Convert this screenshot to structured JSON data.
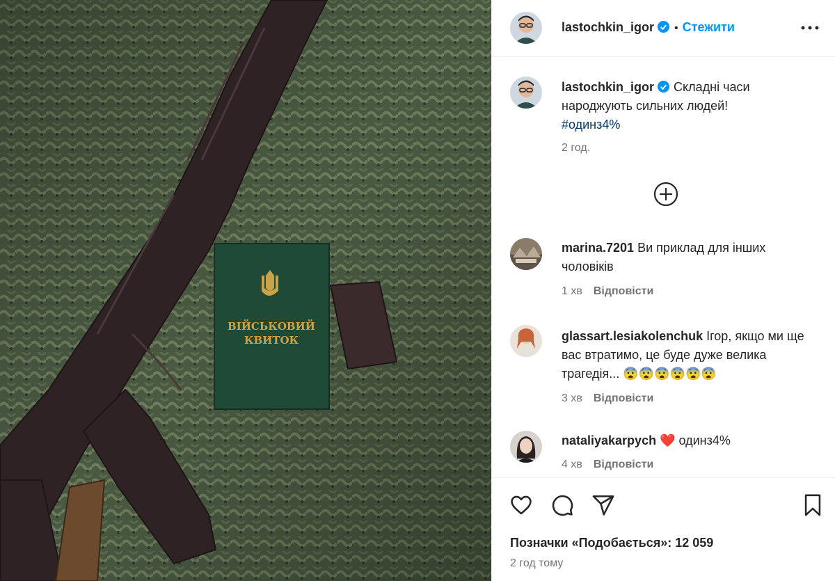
{
  "post": {
    "author": "lastochkin_igor",
    "follow_label": "Стежити",
    "dot": "•",
    "more_icon": "more-options-icon",
    "caption": "Складні часи народжують сильних людей!",
    "hashtag": "#одинз4%",
    "caption_time": "2 год.",
    "image_booklet_line1": "ВІЙСЬКОВИЙ",
    "image_booklet_line2": "КВИТОК"
  },
  "comments": [
    {
      "user": "marina.7201",
      "text": "Ви приклад для інших чоловіків",
      "time": "1 хв",
      "reply": "Відповісти"
    },
    {
      "user": "glassart.lesiakolenchuk",
      "text": "Ігор, якщо ми ще вас втратимо, це буде дуже велика трагедія... 😨😨😨😨😨😨",
      "time": "3 хв",
      "reply": "Відповісти"
    },
    {
      "user": "nataliyakarpych",
      "text": "❤️ одинз4%",
      "time": "4 хв",
      "reply": "Відповісти"
    }
  ],
  "footer": {
    "likes": "Позначки «Подобається»: 12 059",
    "time_ago": "2 год тому"
  },
  "colors": {
    "accent": "#0095f6",
    "verified": "#0095f6",
    "hashtag": "#00376b",
    "muted": "#737373"
  }
}
